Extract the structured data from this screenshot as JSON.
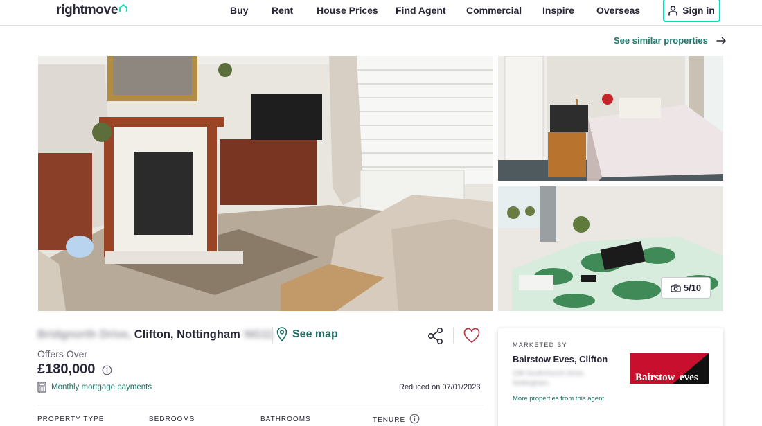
{
  "header": {
    "logo_text": "rightmove",
    "nav": [
      {
        "label": "Buy"
      },
      {
        "label": "Rent"
      },
      {
        "label": "House Prices"
      },
      {
        "label": "Find Agent"
      },
      {
        "label": "Commercial"
      },
      {
        "label": "Inspire"
      },
      {
        "label": "Overseas"
      }
    ],
    "signin_label": "Sign in"
  },
  "see_similar_label": "See similar properties",
  "gallery": {
    "photo_count": "5/10"
  },
  "listing": {
    "address_street_redacted": "Bridgnorth Drive,",
    "address_visible": "Clifton, Nottingham",
    "address_postcode_redacted": "NG11",
    "see_map_label": "See map",
    "price_qualifier": "Offers Over",
    "price": "£180,000",
    "mortgage_label": "Monthly mortgage payments",
    "reduced_text": "Reduced on 07/01/2023",
    "key_features": [
      {
        "label": "PROPERTY TYPE"
      },
      {
        "label": "BEDROOMS"
      },
      {
        "label": "BATHROOMS"
      },
      {
        "label": "TENURE"
      }
    ]
  },
  "agent": {
    "marketed_by": "MARKETED BY",
    "name": "Bairstow Eves, Clifton",
    "address_line1_redacted": "238 Southchurch Drive,",
    "address_line2_redacted": "Nottingham,",
    "more_link": "More properties from this agent",
    "logo_text_left": "Bairstow",
    "logo_text_right": "eves"
  },
  "colors": {
    "brand_teal": "#00deb6",
    "link_green": "#1d6f63",
    "text_dark": "#262637",
    "agent_logo_red": "#c8102e",
    "agent_logo_black": "#111111"
  }
}
